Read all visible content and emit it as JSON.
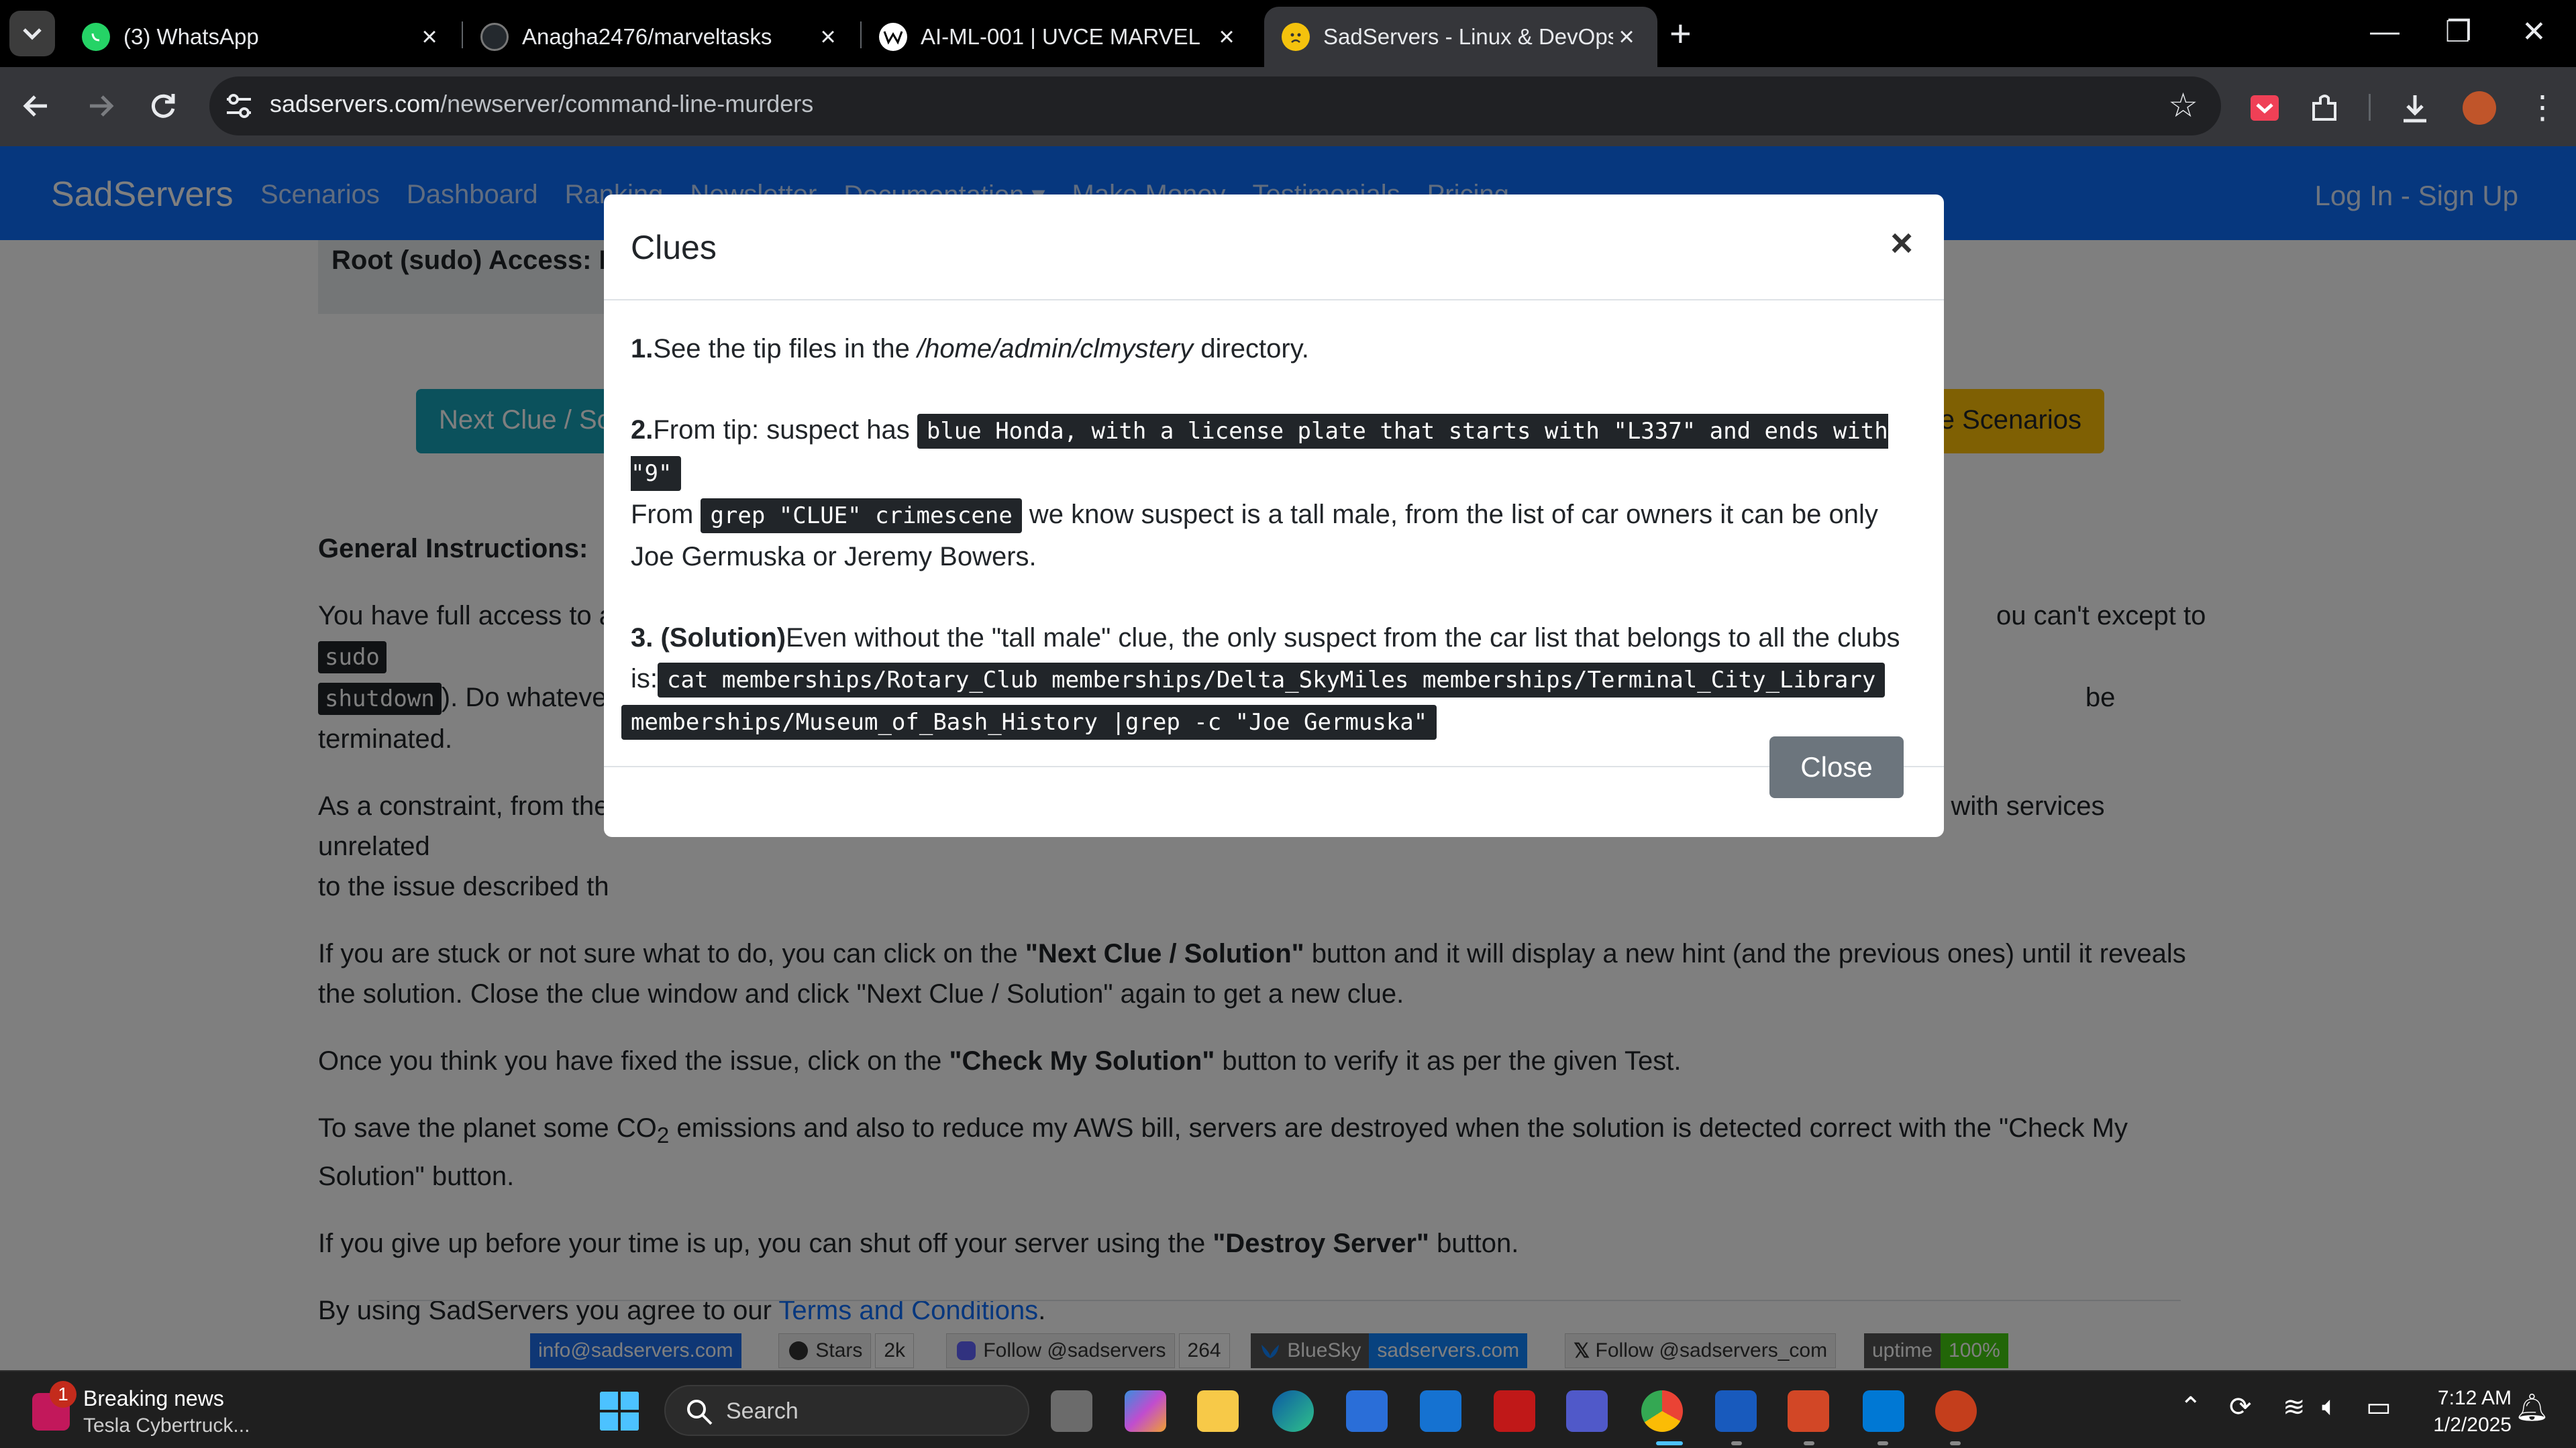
{
  "browser": {
    "tabs": [
      {
        "title": "(3) WhatsApp",
        "icon": "whatsapp-icon"
      },
      {
        "title": "Anagha2476/marveltasks",
        "icon": "github-icon"
      },
      {
        "title": "AI-ML-001 | UVCE MARVEL",
        "icon": "marvel-icon"
      },
      {
        "title": "SadServers - Linux & DevOps Tr",
        "icon": "sadservers-icon",
        "active": true
      }
    ],
    "url_host": "sadservers.com",
    "url_path": "/newserver/command-line-murders"
  },
  "site": {
    "brand": "SadServers",
    "nav": [
      "Scenarios",
      "Dashboard",
      "Ranking",
      "Newsletter",
      "Documentation ▾",
      "Make Money",
      "Testimonials",
      "Pricing"
    ],
    "login": "Log In",
    "sep": " - ",
    "signup": "Sign Up",
    "root_access": "Root (sudo) Access: N",
    "next_clue_btn": "Next Clue / So",
    "more_scenarios_btn": "re Scenarios"
  },
  "instructions": {
    "heading": "General Instructions:",
    "p1_a": "You have full access to a",
    "p1_b": "ou can't except to",
    "p1_code1": "sudo",
    "p1_code2": "shutdown",
    "p1_c": "). Do whatever",
    "p1_d": "be terminated.",
    "p2_a": "As a constraint, from the",
    "p2_b": "with services unrelated",
    "p2_c": "to the issue described th",
    "p3_a": "If you are stuck or not sure what to do, you can click on the",
    "p3_b": "\"Next Clue / Solution\"",
    "p3_c": "button and it will display a new hint (and the previous ones) until it reveals the solution. Close the clue window and click \"Next Clue / Solution\" again to get a new clue.",
    "p4_a": "Once you think you have fixed the issue, click on the",
    "p4_b": "\"Check My Solution\"",
    "p4_c": "button to verify it as per the given Test.",
    "p5_a": "To save the planet some CO",
    "p5_sub": "2",
    "p5_b": "emissions and also to reduce my AWS bill, servers are destroyed when the solution is detected correct with the \"Check My Solution\" button.",
    "p6_a": "If you give up before your time is up, you can shut off your server using the",
    "p6_b": "\"Destroy Server\"",
    "p6_c": "button.",
    "p7_a": "By using SadServers you agree to our",
    "p7_link": "Terms and Conditions",
    "p7_b": "."
  },
  "footer_badges": {
    "email": "info@sadservers.com",
    "stars_label": "Stars",
    "stars_count": "2k",
    "mastodon_label": "Follow @sadservers",
    "mastodon_count": "264",
    "bluesky_label": "BlueSky",
    "bluesky_value": "sadservers.com",
    "x_label": "Follow @sadservers_com",
    "uptime_label": "uptime",
    "uptime_value": "100%"
  },
  "modal": {
    "title": "Clues",
    "close_x": "×",
    "clue1_num": "1.",
    "clue1_a": "See the tip files in the",
    "clue1_path": "/home/admin/clmystery",
    "clue1_b": "directory.",
    "clue2_num": "2.",
    "clue2_a": "From tip: suspect has",
    "clue2_code1": "blue Honda, with a license plate that starts with \"L337\" and ends with \"9\"",
    "clue2_b": "From",
    "clue2_code2": "grep \"CLUE\" crimescene",
    "clue2_c": "we know suspect is a tall male, from the list of car owners it can be only Joe Germuska or Jeremy Bowers.",
    "clue3_num": "3. (Solution)",
    "clue3_a": "Even without the \"tall male\" clue, the only suspect from the car list that belongs to all the clubs is:",
    "clue3_code1": "cat memberships/Rotary_Club memberships/Delta_SkyMiles memberships/Terminal_City_Library",
    "clue3_code2": "memberships/Museum_of_Bash_History |grep -c \"Joe Germuska\"",
    "close_button": "Close"
  },
  "taskbar": {
    "news_badge": "1",
    "news_title": "Breaking news",
    "news_sub": "Tesla Cybertruck...",
    "search_placeholder": "Search",
    "time": "7:12 AM",
    "date": "1/2/2025"
  },
  "colors": {
    "brand_blue": "#0d6efd",
    "info_button": "#17a2b8",
    "warning_button": "#ffc107",
    "secondary_button": "#6c757d"
  }
}
